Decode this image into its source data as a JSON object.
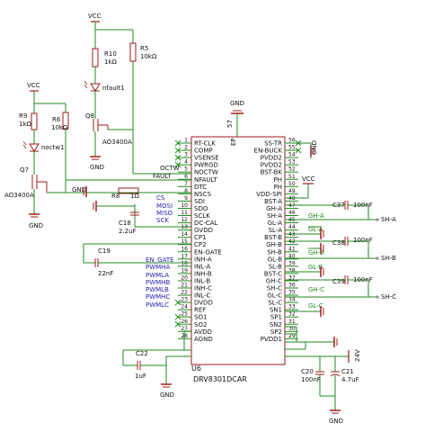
{
  "colors": {
    "wire": "#1f8a1f",
    "body": "#a01a1a",
    "label": "#111111",
    "ref": "#111111",
    "netlabel": "#1f1fb0",
    "nc": "#1f8a1f"
  },
  "power": {
    "vcc": "VCC",
    "gnd": "GND"
  },
  "parts": {
    "r10": {
      "ref": "R10",
      "val": "1kΩ"
    },
    "r5": {
      "ref": "R5",
      "val": "10kΩ"
    },
    "led_fault": {
      "ref": "nfault1"
    },
    "r9": {
      "ref": "R9",
      "val": "1kΩ"
    },
    "r6": {
      "ref": "R6",
      "val": "10kΩ"
    },
    "q8": {
      "ref": "Q8",
      "val": "AO3400A"
    },
    "led_octw": {
      "ref": "noctw1"
    },
    "q7": {
      "ref": "Q7",
      "val": "AO3400A"
    },
    "r8": {
      "ref": "R8",
      "val": "1Ω"
    },
    "c18": {
      "ref": "C18",
      "val": "2.2uF"
    },
    "c19": {
      "ref": "C19",
      "val": "22nF"
    },
    "c22": {
      "ref": "C22",
      "val": "1uF"
    },
    "c37": {
      "ref": "C37",
      "val": "100nF"
    },
    "c38": {
      "ref": "C38",
      "val": "100nF"
    },
    "c39": {
      "ref": "C39",
      "val": "100nF"
    },
    "c20": {
      "ref": "C20",
      "val": "100nF"
    },
    "c21": {
      "ref": "C21",
      "val": "4.7uF"
    },
    "u6": {
      "ref": "U6",
      "val": "DRV8301DCAR",
      "ep": "EP",
      "ep_num": "57"
    }
  },
  "nets": {
    "octw": "OCTW",
    "fault": "FAULT",
    "v24": "24V",
    "cs": "CS",
    "mosi": "MOSI",
    "miso": "MISO",
    "sck": "SCK",
    "en_gate": "EN_GATE",
    "pwmha": "PWMHA",
    "pwmla": "PWMLA",
    "pwmhb": "PWMHB",
    "pwmlb": "PWMLB",
    "pwmhc": "PWMHC",
    "pwmlc": "PWMLC",
    "gh_a": "GH-A",
    "gl_a": "GL-A",
    "gh_b": "GH-B",
    "gl_b": "GL-B",
    "gh_c": "GH-C",
    "gl_c": "GL-C",
    "sh_a": "SH-A",
    "sh_b": "SH-B",
    "sh_c": "SH-C"
  },
  "left_pins": [
    {
      "num": "1",
      "name": "RT-CLK"
    },
    {
      "num": "2",
      "name": "COMP"
    },
    {
      "num": "3",
      "name": "VSENSE"
    },
    {
      "num": "4",
      "name": "PWRGD"
    },
    {
      "num": "5",
      "name": "NOCTW"
    },
    {
      "num": "6",
      "name": "NFAULT"
    },
    {
      "num": "7",
      "name": "DTC"
    },
    {
      "num": "8",
      "name": "NSCS"
    },
    {
      "num": "9",
      "name": "SDI"
    },
    {
      "num": "10",
      "name": "SDO"
    },
    {
      "num": "11",
      "name": "SCLK"
    },
    {
      "num": "12",
      "name": "DC-CAL"
    },
    {
      "num": "13",
      "name": "GVDD"
    },
    {
      "num": "14",
      "name": "CP1"
    },
    {
      "num": "15",
      "name": "CP2"
    },
    {
      "num": "16",
      "name": "EN-GATE"
    },
    {
      "num": "17",
      "name": "INH-A"
    },
    {
      "num": "18",
      "name": "INL-A"
    },
    {
      "num": "19",
      "name": "INH-B"
    },
    {
      "num": "20",
      "name": "INL-B"
    },
    {
      "num": "21",
      "name": "INH-C"
    },
    {
      "num": "22",
      "name": "INL-C"
    },
    {
      "num": "23",
      "name": "DVDD"
    },
    {
      "num": "24",
      "name": "REF"
    },
    {
      "num": "25",
      "name": "SO1"
    },
    {
      "num": "26",
      "name": "SO2"
    },
    {
      "num": "27",
      "name": "AVDD"
    },
    {
      "num": "28",
      "name": "AGND"
    }
  ],
  "right_pins": [
    {
      "num": "56",
      "name": "SS-TR"
    },
    {
      "num": "55",
      "name": "EN-BUCK"
    },
    {
      "num": "54",
      "name": "PVDD2"
    },
    {
      "num": "53",
      "name": "PVDD2"
    },
    {
      "num": "52",
      "name": "BST-BK"
    },
    {
      "num": "51",
      "name": "PH"
    },
    {
      "num": "50",
      "name": "PH"
    },
    {
      "num": "49",
      "name": "VDD-SPI"
    },
    {
      "num": "48",
      "name": "BST-A"
    },
    {
      "num": "47",
      "name": "GH-A"
    },
    {
      "num": "46",
      "name": "SH-A"
    },
    {
      "num": "45",
      "name": "GL-A"
    },
    {
      "num": "44",
      "name": "SL-A"
    },
    {
      "num": "43",
      "name": "BST-B"
    },
    {
      "num": "42",
      "name": "GH-B"
    },
    {
      "num": "41",
      "name": "SH-B"
    },
    {
      "num": "40",
      "name": "GL-B"
    },
    {
      "num": "39",
      "name": "SL-B"
    },
    {
      "num": "38",
      "name": "BST-C"
    },
    {
      "num": "37",
      "name": "GH-C"
    },
    {
      "num": "36",
      "name": "SH-C"
    },
    {
      "num": "35",
      "name": "GL-C"
    },
    {
      "num": "34",
      "name": "SL-C"
    },
    {
      "num": "33",
      "name": "SN1"
    },
    {
      "num": "32",
      "name": "SP1"
    },
    {
      "num": "31",
      "name": "SN2"
    },
    {
      "num": "30",
      "name": "SP2"
    },
    {
      "num": "29",
      "name": "PVDD1"
    }
  ]
}
